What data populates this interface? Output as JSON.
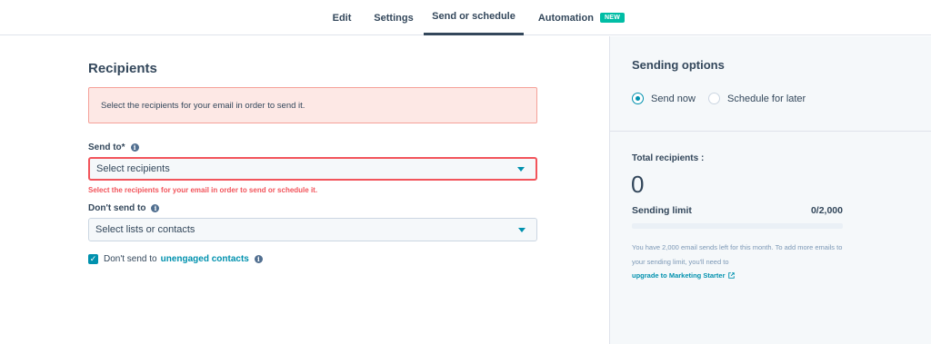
{
  "tabs": [
    {
      "label": "Edit"
    },
    {
      "label": "Settings"
    },
    {
      "label": "Send or schedule"
    },
    {
      "label": "Automation",
      "badge": "NEW"
    }
  ],
  "recipients": {
    "title": "Recipients",
    "alert": "Select the recipients for your email in order to send it.",
    "send_to_label": "Send to*",
    "send_to_placeholder": "Select recipients",
    "send_to_error": "Select the recipients for your email in order to send or schedule it.",
    "dont_send_label": "Don't send to",
    "dont_send_placeholder": "Select lists or contacts",
    "checkbox_text": "Don't send to",
    "checkbox_link": "unengaged contacts",
    "checkbox_checked": true
  },
  "sending_options": {
    "title": "Sending options",
    "send_now": "Send now",
    "schedule_later": "Schedule for later",
    "selected": "send_now",
    "total_label": "Total recipients :",
    "total_value": "0",
    "limit_label": "Sending limit",
    "limit_value": "0/2,000",
    "limit_fraction": 0,
    "info_text": "You have 2,000 email sends left for this month. To add more emails to your sending limit, you'll need to",
    "upgrade_link": "upgrade to Marketing Starter"
  },
  "colors": {
    "accent": "#0091ae",
    "error": "#f2545b",
    "text": "#33475b",
    "badge": "#00bda5"
  }
}
